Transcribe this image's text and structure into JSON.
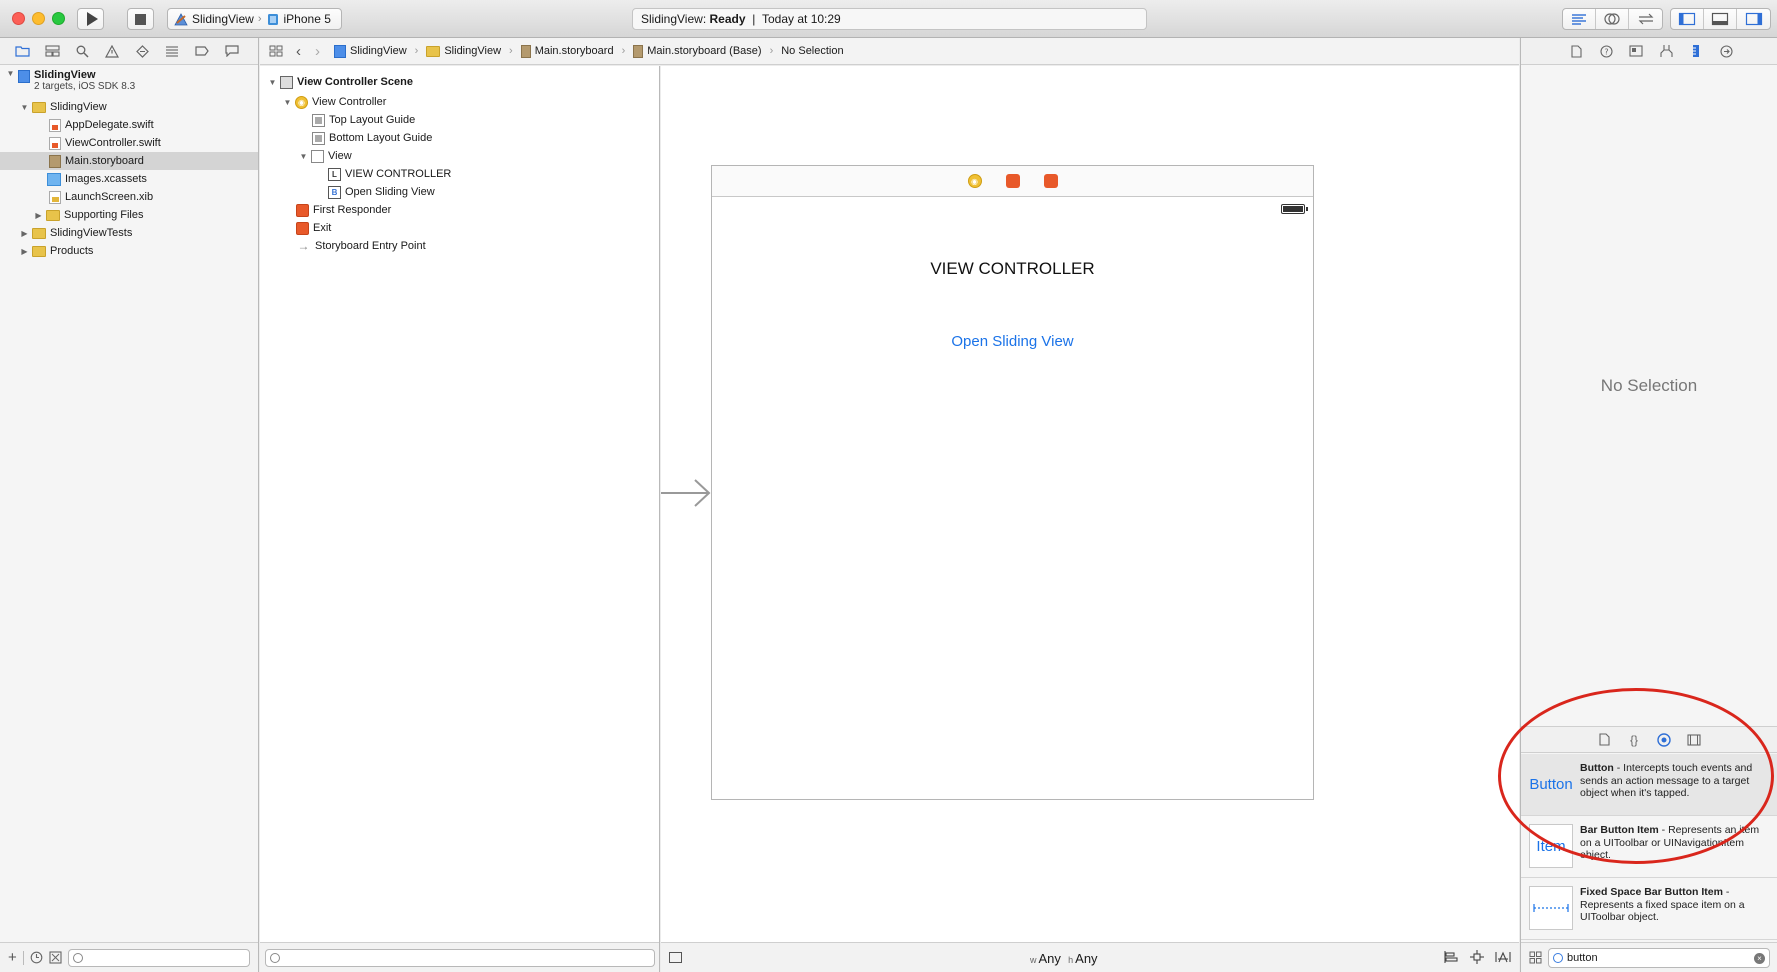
{
  "toolbar": {
    "scheme_target": "SlidingView",
    "scheme_device": "iPhone 5",
    "activity_project": "SlidingView:",
    "activity_status": "Ready",
    "activity_separator": "|",
    "activity_time": "Today at 10:29"
  },
  "navigator": {
    "project": {
      "name": "SlidingView",
      "subtitle": "2 targets, iOS SDK 8.3"
    },
    "items": [
      {
        "label": "SlidingView"
      },
      {
        "label": "AppDelegate.swift"
      },
      {
        "label": "ViewController.swift"
      },
      {
        "label": "Main.storyboard"
      },
      {
        "label": "Images.xcassets"
      },
      {
        "label": "LaunchScreen.xib"
      },
      {
        "label": "Supporting Files"
      },
      {
        "label": "SlidingViewTests"
      },
      {
        "label": "Products"
      }
    ],
    "filter_placeholder": ""
  },
  "jumpbar": {
    "crumbs": [
      "SlidingView",
      "SlidingView",
      "Main.storyboard",
      "Main.storyboard (Base)",
      "No Selection"
    ]
  },
  "outline": {
    "items": [
      {
        "label": "View Controller Scene"
      },
      {
        "label": "View Controller"
      },
      {
        "label": "Top Layout Guide"
      },
      {
        "label": "Bottom Layout Guide"
      },
      {
        "label": "View"
      },
      {
        "label": "VIEW CONTROLLER"
      },
      {
        "label": "Open Sliding View"
      },
      {
        "label": "First Responder"
      },
      {
        "label": "Exit"
      },
      {
        "label": "Storyboard Entry Point"
      }
    ],
    "label_icon": "L",
    "button_icon": "B"
  },
  "canvas": {
    "label_text": "VIEW CONTROLLER",
    "button_text": "Open Sliding View",
    "size_w_prefix": "w",
    "size_w": "Any",
    "size_h_prefix": "h",
    "size_h": "Any"
  },
  "utilities": {
    "no_selection": "No Selection",
    "library": [
      {
        "thumb": "Button",
        "title": "Button",
        "desc": " - Intercepts touch events and sends an action message to a target object when it's tapped."
      },
      {
        "thumb": "Item",
        "title": "Bar Button Item",
        "desc": " - Represents an item on a UIToolbar or UINavigationItem object."
      },
      {
        "thumb": "",
        "title": "Fixed Space Bar Button Item",
        "desc": " - Represents a fixed space item on a UIToolbar object."
      }
    ],
    "search_value": "button"
  },
  "colors": {
    "accent": "#1b73e8",
    "annotation": "#d9261c",
    "folder": "#e8c34a"
  }
}
